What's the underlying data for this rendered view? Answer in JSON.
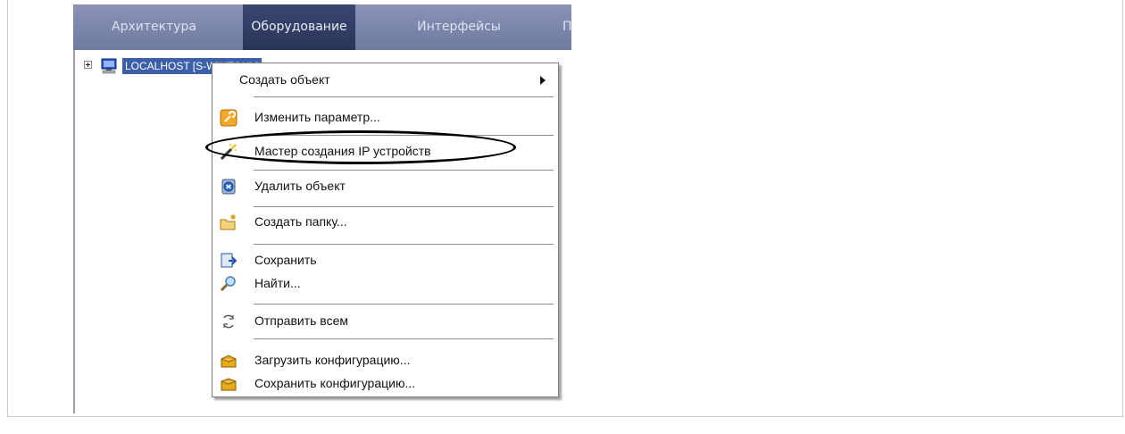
{
  "tabs": [
    {
      "label": "Архитектура",
      "active": false
    },
    {
      "label": "Оборудование",
      "active": true
    },
    {
      "label": "Интерфейсы",
      "active": false
    },
    {
      "label": "П",
      "active": false
    }
  ],
  "tree": {
    "node_label": "LOCALHOST [S-WINTOHL]",
    "node_icon": "computer-icon",
    "selected_color": "#3b5fa9"
  },
  "context_menu": {
    "items": [
      {
        "label": "Создать объект",
        "icon": null,
        "has_submenu": true
      },
      {
        "label": "Изменить параметр...",
        "icon": "edit-params-icon"
      },
      {
        "label": "Мастер создания IP устройств",
        "icon": "wizard-wand-icon",
        "highlighted_by_ellipse": true
      },
      {
        "label": "Удалить объект",
        "icon": "delete-object-icon"
      },
      {
        "label": "Создать папку...",
        "icon": "new-folder-icon"
      },
      {
        "label": "Сохранить",
        "icon": "save-icon"
      },
      {
        "label": "Найти...",
        "icon": "search-icon"
      },
      {
        "label": "Отправить всем",
        "icon": "send-all-icon"
      },
      {
        "label": "Загрузить конфигурацию...",
        "icon": "load-config-icon"
      },
      {
        "label": "Сохранить конфигурацию...",
        "icon": "save-config-icon"
      }
    ]
  },
  "colors": {
    "tabbar": "#7a84aa",
    "active_tab": "#2f3a62",
    "selection": "#3b5fa9"
  }
}
